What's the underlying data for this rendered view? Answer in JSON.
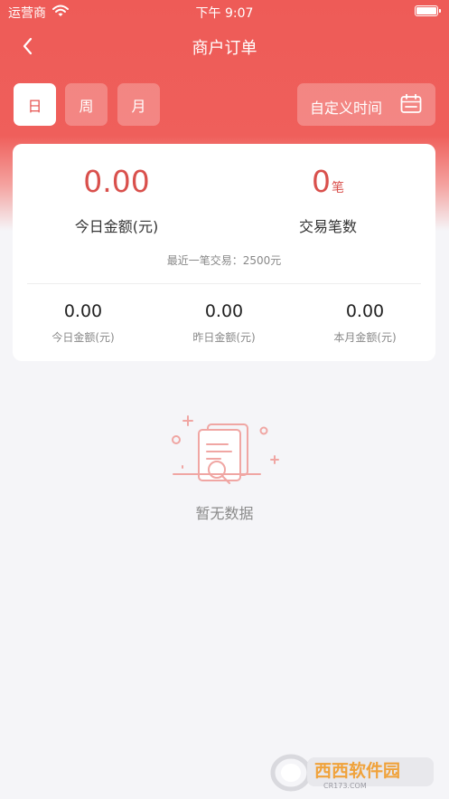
{
  "status_bar": {
    "carrier": "运营商",
    "time": "下午 9:07"
  },
  "nav": {
    "title": "商户订单",
    "back_icon": "chevron-left-icon"
  },
  "periods": [
    {
      "label": "日",
      "active": true
    },
    {
      "label": "周",
      "active": false
    },
    {
      "label": "月",
      "active": false
    }
  ],
  "custom_time": {
    "label": "自定义时间",
    "icon": "calendar-icon"
  },
  "summary": {
    "today_amount": "0.00",
    "today_amount_label": "今日金额(元)",
    "count": "0",
    "count_unit": "笔",
    "count_label": "交易笔数",
    "recent": "最近一笔交易：2500元"
  },
  "stats": [
    {
      "value": "0.00",
      "label": "今日金额(元)"
    },
    {
      "value": "0.00",
      "label": "昨日金额(元)"
    },
    {
      "value": "0.00",
      "label": "本月金额(元)"
    }
  ],
  "empty": {
    "text": "暂无数据",
    "icon": "document-search-icon"
  },
  "watermark": {
    "text": "西西软件园",
    "sub": "CR173.COM"
  },
  "colors": {
    "primary": "#ee5b57",
    "accent_text": "#d9504c",
    "background": "#f5f5f8"
  }
}
